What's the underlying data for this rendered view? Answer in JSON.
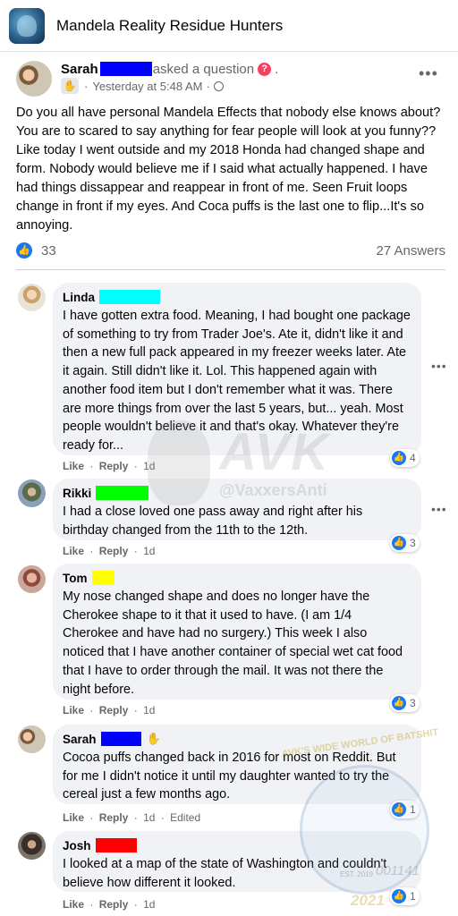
{
  "group": {
    "name": "Mandela Reality Residue Hunters"
  },
  "post": {
    "author": "Sarah",
    "action": "asked a question",
    "question_glyph": "?",
    "trailing_dot": ".",
    "timestamp": "Yesterday at 5:48 AM",
    "separator": "·",
    "audience_icon": "public-globe-icon",
    "body": "Do you all have personal Mandela Effects that nobody else knows about? You are to scared to say anything for fear people will look at you funny?? Like today I went outside and my 2018 Honda had changed shape and  form. Nobody would believe me if I said what actually happened.  I have had things dissappear and reappear in front of me. Seen Fruit loops change in front if my eyes. And Coca puffs is the last one to flip...It's so annoying.",
    "likes": "33",
    "answers": "27 Answers",
    "more_glyph": "•••"
  },
  "comment_actions": {
    "like": "Like",
    "reply": "Reply",
    "dot": "·"
  },
  "comments": [
    {
      "author": "Linda",
      "redact_color": "#00ffff",
      "text": "I have gotten extra food. Meaning, I had bought one package of something to try from Trader Joe's. Ate it, didn't like it and then a new full pack appeared in my freezer weeks later. Ate it again. Still didn't like it. Lol. This happened again with another food item but I don't remember what it was. There are more things from over the last 5 years, but... yeah. Most people wouldn't believe it and that's okay. Whatever they're ready for...",
      "age": "1d",
      "reactions": "4",
      "edited": ""
    },
    {
      "author": "Rikki",
      "redact_color": "#00ff00",
      "text": "I had a close loved one pass away and right after his birthday changed from the 11th to the 12th.",
      "age": "1d",
      "reactions": "3",
      "edited": ""
    },
    {
      "author": "Tom",
      "redact_color": "#ffff00",
      "text": "My nose changed shape and does no longer have the Cherokee shape to it that it used to have. (I am 1/4 Cherokee and have had no surgery.) This week I also noticed that I have another container of special wet cat food that I have to order through the mail. It was not there the night before.",
      "age": "1d",
      "reactions": "3",
      "edited": ""
    },
    {
      "author": "Sarah",
      "redact_color": "#0000ff",
      "text": "Cocoa puffs changed back in 2016 for most on Reddit. But for me I didn't notice it until my daughter wanted to try the cereal just a few months ago.",
      "age": "1d",
      "reactions": "1",
      "edited": "Edited"
    },
    {
      "author": "Josh",
      "redact_color": "#ff0000",
      "text": "I looked at a map of the state of Washington and couldn't believe how different it looked.",
      "age": "1d",
      "reactions": "1",
      "edited": ""
    }
  ],
  "watermarks": {
    "avk": "AVK",
    "handle": "@VaxxersAnti",
    "arc": "AVK'S WIDE WORLD OF BATSHIT",
    "est": "EST. 2019",
    "num": "001141",
    "year": "2021"
  },
  "colors": {
    "like_blue": "#1877f2",
    "bubble": "#f0f2f5",
    "meta_gray": "#65676b",
    "question_red": "#f3425f",
    "post_redact": "#0000ff"
  }
}
